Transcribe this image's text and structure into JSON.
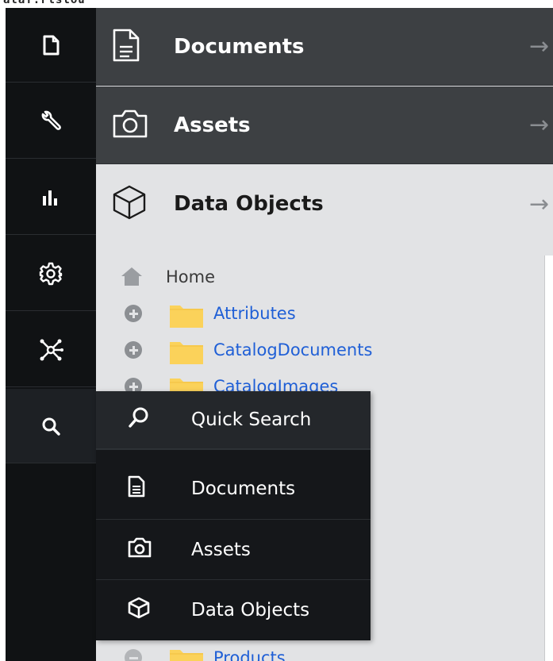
{
  "top_strip_text": "ataf.rtslou",
  "rail": {
    "items": [
      {
        "icon": "file-icon",
        "name": "rail-documents"
      },
      {
        "icon": "wrench-icon",
        "name": "rail-tools"
      },
      {
        "icon": "bar-chart-icon",
        "name": "rail-reports"
      },
      {
        "icon": "gear-icon",
        "name": "rail-settings"
      },
      {
        "icon": "network-icon",
        "name": "rail-datahub"
      },
      {
        "icon": "search-icon",
        "name": "rail-search"
      }
    ]
  },
  "accordion": {
    "documents": {
      "title": "Documents",
      "arrow": "→"
    },
    "assets": {
      "title": "Assets",
      "arrow": "→"
    },
    "data_objects": {
      "title": "Data Objects",
      "arrow": "→"
    }
  },
  "tree": {
    "home_label": "Home",
    "items": [
      {
        "label": "Attributes",
        "expander": "plus"
      },
      {
        "label": "CatalogDocuments",
        "expander": "plus"
      },
      {
        "label": "CatalogImages",
        "expander": "plus"
      },
      {
        "label": "Products",
        "expander": "minus"
      }
    ]
  },
  "search_menu": {
    "quick_search": "Quick Search",
    "items": [
      {
        "label": "Documents",
        "icon": "document-icon"
      },
      {
        "label": "Assets",
        "icon": "camera-icon"
      },
      {
        "label": "Data Objects",
        "icon": "cube-icon"
      }
    ]
  },
  "colors": {
    "rail_bg": "#101214",
    "header_dark": "#3d4043",
    "panel_bg": "#e2e3e5",
    "link_blue": "#1f5fd6",
    "folder_yellow": "#fbd25a"
  }
}
